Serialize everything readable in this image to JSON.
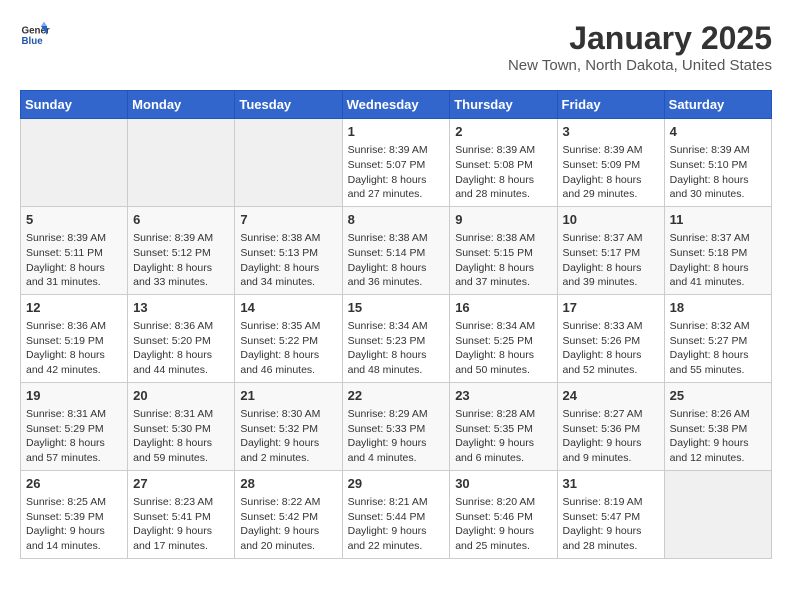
{
  "header": {
    "logo_general": "General",
    "logo_blue": "Blue",
    "month_title": "January 2025",
    "location": "New Town, North Dakota, United States"
  },
  "weekdays": [
    "Sunday",
    "Monday",
    "Tuesday",
    "Wednesday",
    "Thursday",
    "Friday",
    "Saturday"
  ],
  "weeks": [
    [
      {
        "day": "",
        "empty": true
      },
      {
        "day": "",
        "empty": true
      },
      {
        "day": "",
        "empty": true
      },
      {
        "day": "1",
        "sunrise": "8:39 AM",
        "sunset": "5:07 PM",
        "daylight": "8 hours and 27 minutes."
      },
      {
        "day": "2",
        "sunrise": "8:39 AM",
        "sunset": "5:08 PM",
        "daylight": "8 hours and 28 minutes."
      },
      {
        "day": "3",
        "sunrise": "8:39 AM",
        "sunset": "5:09 PM",
        "daylight": "8 hours and 29 minutes."
      },
      {
        "day": "4",
        "sunrise": "8:39 AM",
        "sunset": "5:10 PM",
        "daylight": "8 hours and 30 minutes."
      }
    ],
    [
      {
        "day": "5",
        "sunrise": "8:39 AM",
        "sunset": "5:11 PM",
        "daylight": "8 hours and 31 minutes."
      },
      {
        "day": "6",
        "sunrise": "8:39 AM",
        "sunset": "5:12 PM",
        "daylight": "8 hours and 33 minutes."
      },
      {
        "day": "7",
        "sunrise": "8:38 AM",
        "sunset": "5:13 PM",
        "daylight": "8 hours and 34 minutes."
      },
      {
        "day": "8",
        "sunrise": "8:38 AM",
        "sunset": "5:14 PM",
        "daylight": "8 hours and 36 minutes."
      },
      {
        "day": "9",
        "sunrise": "8:38 AM",
        "sunset": "5:15 PM",
        "daylight": "8 hours and 37 minutes."
      },
      {
        "day": "10",
        "sunrise": "8:37 AM",
        "sunset": "5:17 PM",
        "daylight": "8 hours and 39 minutes."
      },
      {
        "day": "11",
        "sunrise": "8:37 AM",
        "sunset": "5:18 PM",
        "daylight": "8 hours and 41 minutes."
      }
    ],
    [
      {
        "day": "12",
        "sunrise": "8:36 AM",
        "sunset": "5:19 PM",
        "daylight": "8 hours and 42 minutes."
      },
      {
        "day": "13",
        "sunrise": "8:36 AM",
        "sunset": "5:20 PM",
        "daylight": "8 hours and 44 minutes."
      },
      {
        "day": "14",
        "sunrise": "8:35 AM",
        "sunset": "5:22 PM",
        "daylight": "8 hours and 46 minutes."
      },
      {
        "day": "15",
        "sunrise": "8:34 AM",
        "sunset": "5:23 PM",
        "daylight": "8 hours and 48 minutes."
      },
      {
        "day": "16",
        "sunrise": "8:34 AM",
        "sunset": "5:25 PM",
        "daylight": "8 hours and 50 minutes."
      },
      {
        "day": "17",
        "sunrise": "8:33 AM",
        "sunset": "5:26 PM",
        "daylight": "8 hours and 52 minutes."
      },
      {
        "day": "18",
        "sunrise": "8:32 AM",
        "sunset": "5:27 PM",
        "daylight": "8 hours and 55 minutes."
      }
    ],
    [
      {
        "day": "19",
        "sunrise": "8:31 AM",
        "sunset": "5:29 PM",
        "daylight": "8 hours and 57 minutes."
      },
      {
        "day": "20",
        "sunrise": "8:31 AM",
        "sunset": "5:30 PM",
        "daylight": "8 hours and 59 minutes."
      },
      {
        "day": "21",
        "sunrise": "8:30 AM",
        "sunset": "5:32 PM",
        "daylight": "9 hours and 2 minutes."
      },
      {
        "day": "22",
        "sunrise": "8:29 AM",
        "sunset": "5:33 PM",
        "daylight": "9 hours and 4 minutes."
      },
      {
        "day": "23",
        "sunrise": "8:28 AM",
        "sunset": "5:35 PM",
        "daylight": "9 hours and 6 minutes."
      },
      {
        "day": "24",
        "sunrise": "8:27 AM",
        "sunset": "5:36 PM",
        "daylight": "9 hours and 9 minutes."
      },
      {
        "day": "25",
        "sunrise": "8:26 AM",
        "sunset": "5:38 PM",
        "daylight": "9 hours and 12 minutes."
      }
    ],
    [
      {
        "day": "26",
        "sunrise": "8:25 AM",
        "sunset": "5:39 PM",
        "daylight": "9 hours and 14 minutes."
      },
      {
        "day": "27",
        "sunrise": "8:23 AM",
        "sunset": "5:41 PM",
        "daylight": "9 hours and 17 minutes."
      },
      {
        "day": "28",
        "sunrise": "8:22 AM",
        "sunset": "5:42 PM",
        "daylight": "9 hours and 20 minutes."
      },
      {
        "day": "29",
        "sunrise": "8:21 AM",
        "sunset": "5:44 PM",
        "daylight": "9 hours and 22 minutes."
      },
      {
        "day": "30",
        "sunrise": "8:20 AM",
        "sunset": "5:46 PM",
        "daylight": "9 hours and 25 minutes."
      },
      {
        "day": "31",
        "sunrise": "8:19 AM",
        "sunset": "5:47 PM",
        "daylight": "9 hours and 28 minutes."
      },
      {
        "day": "",
        "empty": true
      }
    ]
  ],
  "labels": {
    "sunrise_prefix": "Sunrise: ",
    "sunset_prefix": "Sunset: ",
    "daylight_prefix": "Daylight: "
  }
}
